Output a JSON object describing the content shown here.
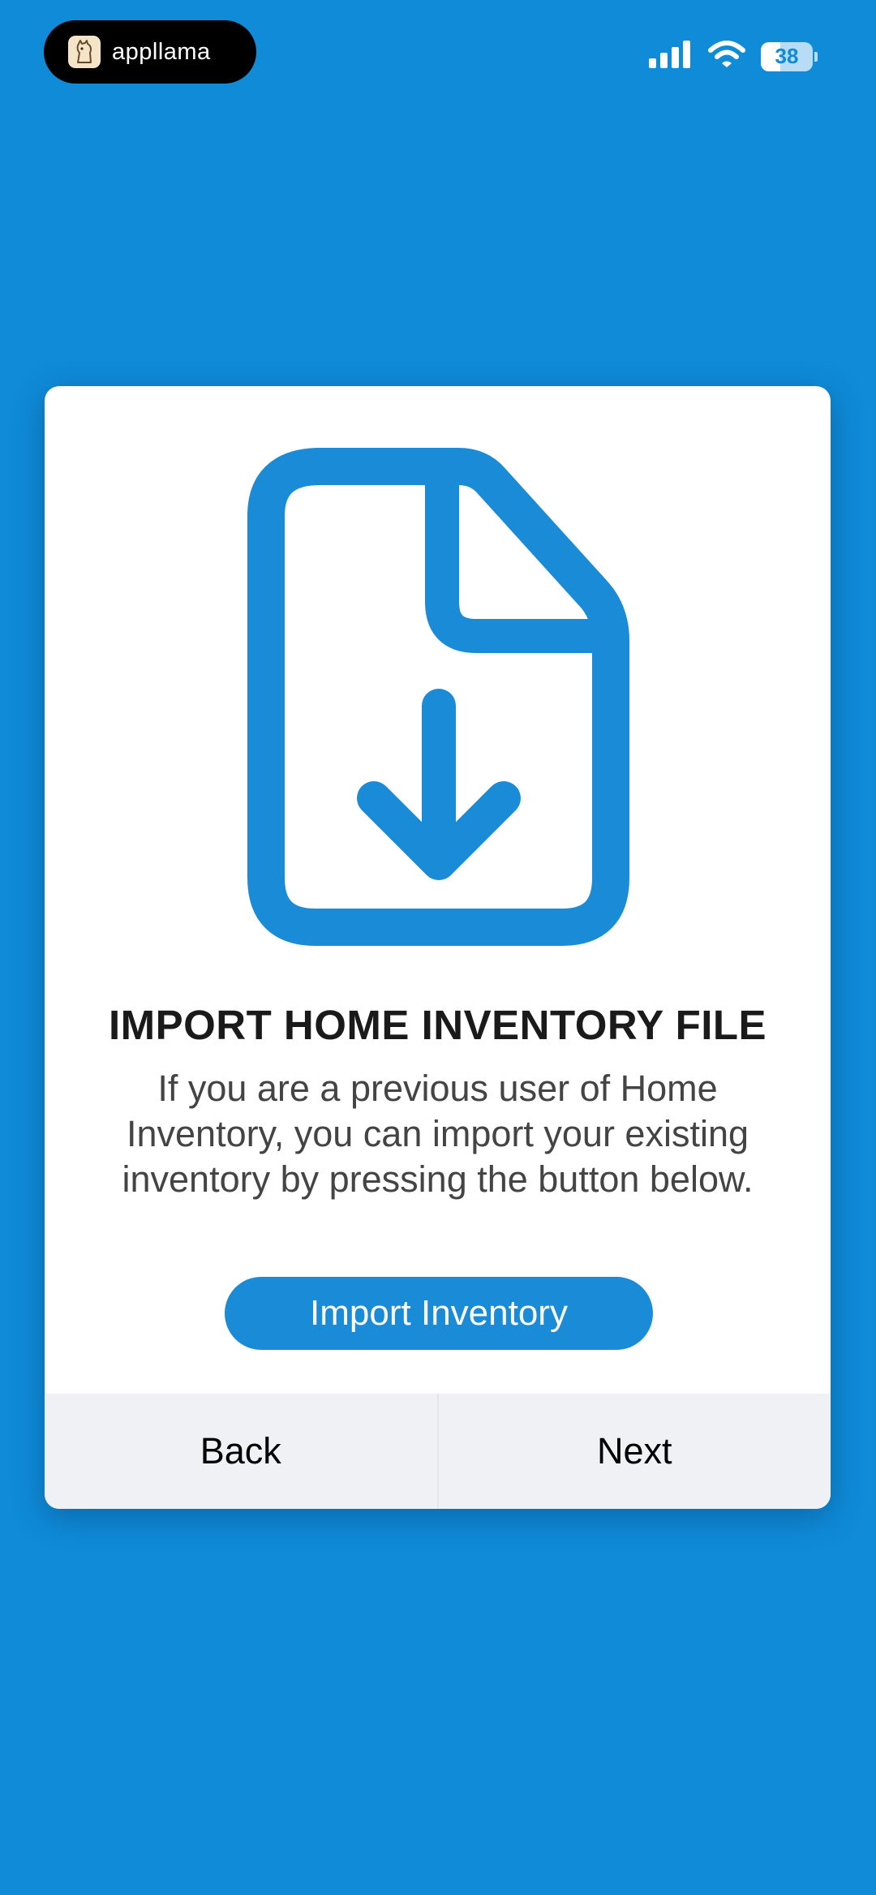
{
  "status_bar": {
    "app_pill_label": "appllama",
    "battery_level": "38"
  },
  "card": {
    "icon": "file-download-icon",
    "title": "IMPORT HOME INVENTORY FILE",
    "description": "If you are a previous user of Home Inventory, you can import your existing inventory by pressing the button below.",
    "import_button_label": "Import Inventory",
    "back_label": "Back",
    "next_label": "Next"
  },
  "colors": {
    "background": "#0f8bd8",
    "accent": "#1a8bd6",
    "card": "#ffffff",
    "footer": "#eff1f4"
  }
}
